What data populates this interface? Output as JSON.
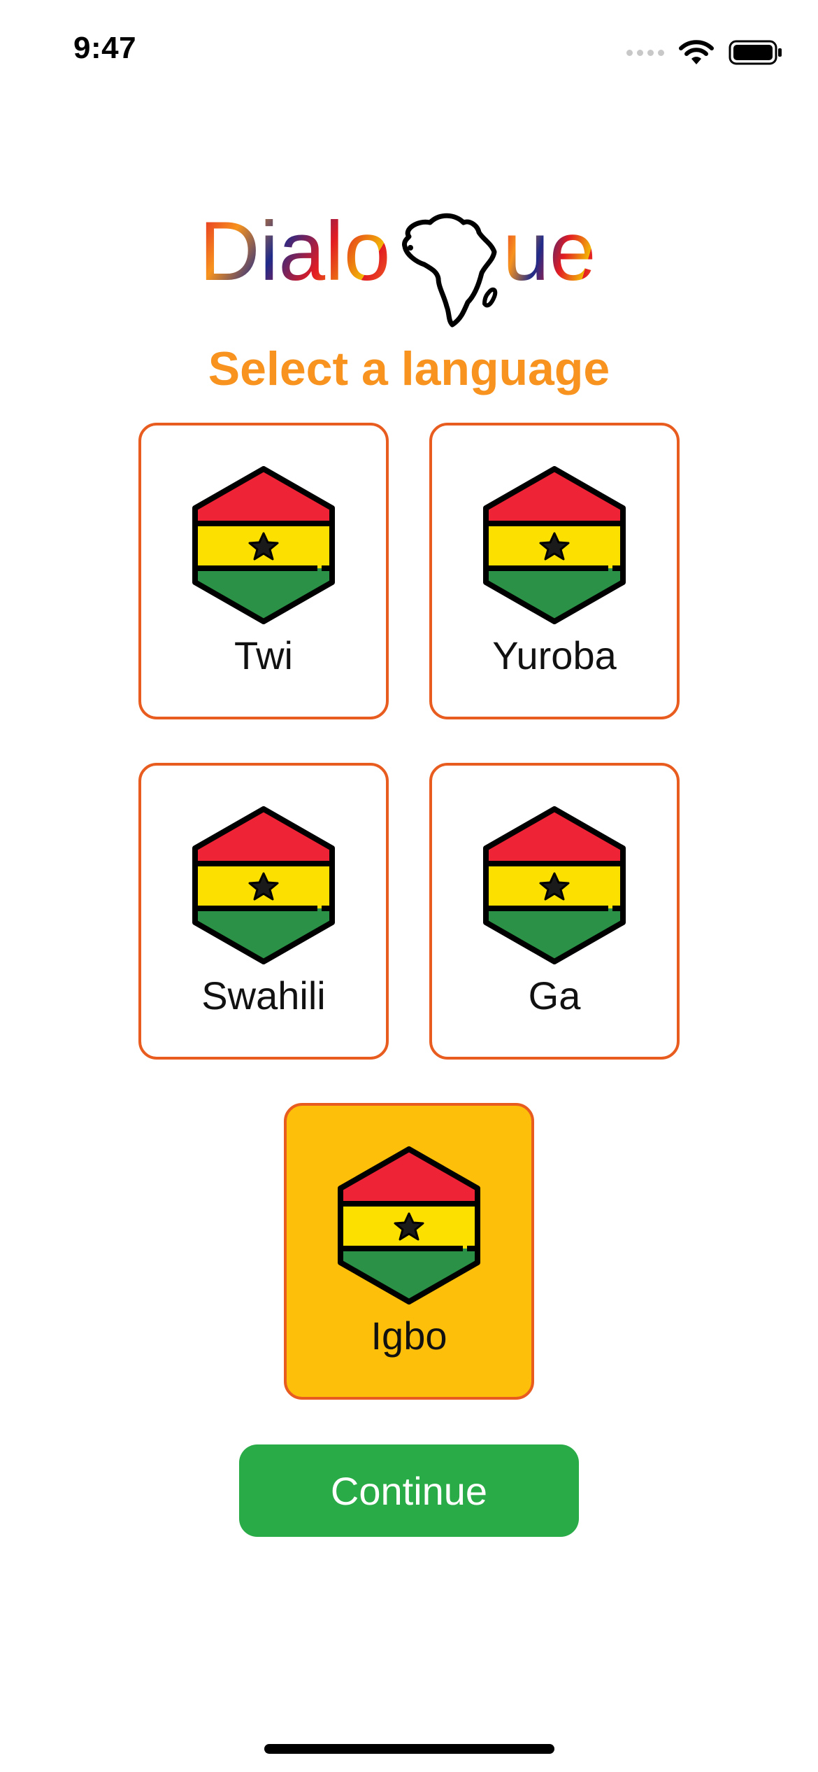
{
  "status_bar": {
    "time": "9:47",
    "icons": [
      "cellular-signal-icon",
      "wifi-icon",
      "battery-icon"
    ]
  },
  "logo": {
    "text_left": "Dialo",
    "text_right": "ue",
    "icon": "africa-map-icon"
  },
  "subtitle": "Select a language",
  "languages": [
    {
      "label": "Twi",
      "icon": "ghana-flag-hexagon-icon",
      "selected": false
    },
    {
      "label": "Yuroba",
      "icon": "ghana-flag-hexagon-icon",
      "selected": false
    },
    {
      "label": "Swahili",
      "icon": "ghana-flag-hexagon-icon",
      "selected": false
    },
    {
      "label": "Ga",
      "icon": "ghana-flag-hexagon-icon",
      "selected": false
    },
    {
      "label": "Igbo",
      "icon": "ghana-flag-hexagon-icon",
      "selected": true
    }
  ],
  "continue_label": "Continue",
  "colors": {
    "accent_orange": "#F7931E",
    "card_border": "#E85D1F",
    "selected_card": "#FDBF09",
    "continue_button": "#29AB47",
    "flag_red": "#EF2336",
    "flag_yellow": "#FCE100",
    "flag_green": "#2A9146"
  }
}
